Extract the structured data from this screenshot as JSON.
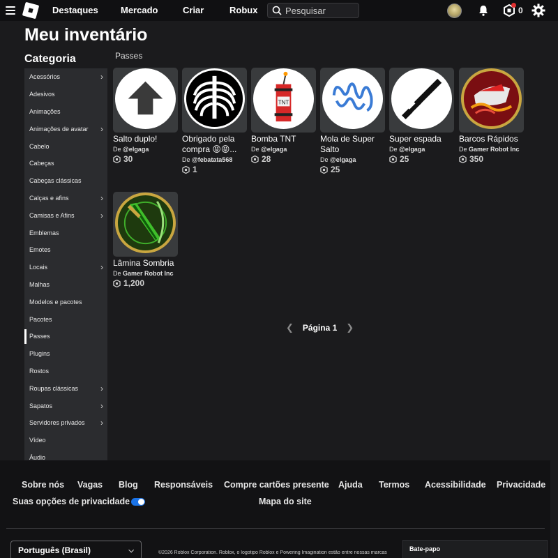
{
  "nav": {
    "links": [
      "Destaques",
      "Mercado",
      "Criar",
      "Robux"
    ],
    "search_placeholder": "Pesquisar",
    "robux_count": "0"
  },
  "main": {
    "title": "Meu inventário",
    "category_heading": "Categoria",
    "section_label": "Passes",
    "categories": [
      {
        "label": "Acessórios",
        "chevron": true
      },
      {
        "label": "Adesivos",
        "chevron": false
      },
      {
        "label": "Animações",
        "chevron": false
      },
      {
        "label": "Animações de avatar",
        "chevron": true
      },
      {
        "label": "Cabelo",
        "chevron": false
      },
      {
        "label": "Cabeças",
        "chevron": false
      },
      {
        "label": "Cabeças clássicas",
        "chevron": false
      },
      {
        "label": "Calças e afins",
        "chevron": true
      },
      {
        "label": "Camisas e Afins",
        "chevron": true
      },
      {
        "label": "Emblemas",
        "chevron": false
      },
      {
        "label": "Emotes",
        "chevron": false
      },
      {
        "label": "Locais",
        "chevron": true
      },
      {
        "label": "Malhas",
        "chevron": false
      },
      {
        "label": "Modelos e pacotes",
        "chevron": false
      },
      {
        "label": "Pacotes",
        "chevron": false
      },
      {
        "label": "Passes",
        "chevron": false,
        "active": true
      },
      {
        "label": "Plugins",
        "chevron": false
      },
      {
        "label": "Rostos",
        "chevron": false
      },
      {
        "label": "Roupas clássicas",
        "chevron": true
      },
      {
        "label": "Sapatos",
        "chevron": true
      },
      {
        "label": "Servidores privados",
        "chevron": true
      },
      {
        "label": "Vídeo",
        "chevron": false
      },
      {
        "label": "Áudio",
        "chevron": false
      }
    ],
    "items": [
      {
        "name": "Salto duplo!",
        "creator_prefix": "De",
        "creator": "@elgaga",
        "price": "30",
        "icon": "arrow-up-icon"
      },
      {
        "name": "Obrigado pela compra 😝😝...",
        "creator_prefix": "De",
        "creator": "@febatata568",
        "price": "1",
        "icon": "ribcage-icon"
      },
      {
        "name": "Bomba TNT",
        "creator_prefix": "De",
        "creator": "@elgaga",
        "price": "28",
        "icon": "tnt-icon"
      },
      {
        "name": "Mola de Super Salto",
        "creator_prefix": "De",
        "creator": "@elgaga",
        "price": "25",
        "icon": "spring-icon"
      },
      {
        "name": "Super espada",
        "creator_prefix": "De",
        "creator": "@elgaga",
        "price": "25",
        "icon": "sword-icon"
      },
      {
        "name": "Barcos Rápidos",
        "creator_prefix": "De",
        "creator": "Gamer Robot Inc",
        "price": "350",
        "icon": "boat-icon"
      },
      {
        "name": "Lâmina Sombria",
        "creator_prefix": "De",
        "creator": "Gamer Robot Inc",
        "price": "1,200",
        "icon": "dark-blade-icon"
      }
    ],
    "pager": {
      "label": "Página 1"
    }
  },
  "footer": {
    "links": [
      "Sobre nós",
      "Vagas",
      "Blog",
      "Responsáveis",
      "Compre cartões presente",
      "Ajuda",
      "Termos",
      "Acessibilidade",
      "Privacidade"
    ],
    "privacy_choices": "Suas opções de privacidade",
    "sitemap": "Mapa do site",
    "language": "Português (Brasil)",
    "copyright": "©2026 Roblox Corporation. Roblox, o logotipo Roblox e Powering Imagination estão entre nossas marcas",
    "chat": "Bate-papo"
  },
  "colors": {
    "background": "#1b1b1d",
    "topbar": "#101012",
    "sidebar": "#2b2c2f",
    "card_thumb": "#393b3d",
    "notification_dot": "#e03030",
    "toggle_blue": "#1a73e8"
  }
}
